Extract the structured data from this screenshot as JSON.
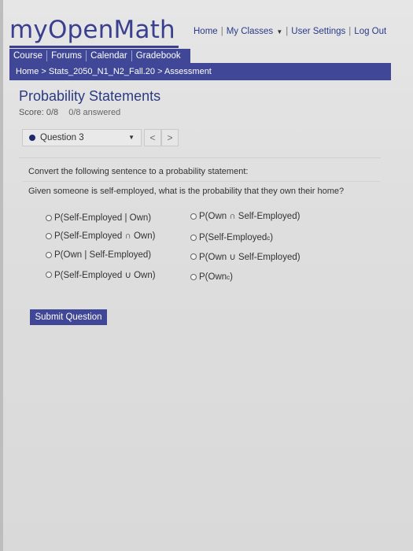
{
  "header": {
    "logo_my": "my",
    "logo_open": "OpenMath",
    "links": {
      "home": "Home",
      "my_classes": "My Classes",
      "user_settings": "User Settings",
      "log_out": "Log Out"
    }
  },
  "nav": {
    "tabs": [
      "Course",
      "Forums",
      "Calendar",
      "Gradebook"
    ]
  },
  "breadcrumb": "Home > Stats_2050_N1_N2_Fall.20 > Assessment",
  "main": {
    "title": "Probability Statements",
    "score": "Score: 0/8",
    "answered": "0/8 answered",
    "question_selector": "Question 3",
    "prev": "<",
    "next": ">",
    "prompt": "Convert the following sentence to a probability statement:",
    "question": "Given someone is self-employed, what is the probability that they own their home?",
    "options": [
      "P(Self-Employed | Own)",
      "P(Self-Employed ∩ Own)",
      "P(Own | Self-Employed)",
      "P(Self-Employed ∪ Own)",
      "P(Own ∩ Self-Employed)",
      "P(Self-Employed",
      "P(Own ∪ Self-Employed)",
      "P(Own"
    ],
    "option_superscript": "c",
    "option_close": ")",
    "submit_label": "Submit Question"
  },
  "colors": {
    "brand": "#3f4796",
    "link": "#2a3a8a"
  }
}
